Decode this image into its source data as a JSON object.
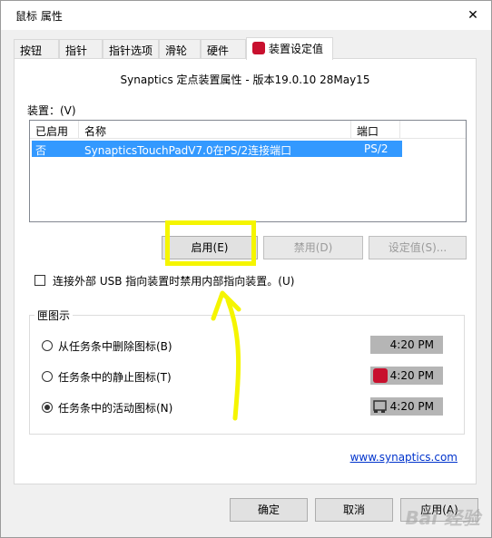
{
  "window": {
    "title": "鼠标 属性",
    "close_glyph": "✕"
  },
  "tabs": [
    "按钮",
    "指针",
    "指针选项",
    "滑轮",
    "硬件",
    "装置设定值"
  ],
  "header_text": "Synaptics 定点装置属性 - 版本19.0.10 28May15",
  "devices_label": "装置：(V)",
  "list": {
    "columns": [
      "已启用",
      "名称",
      "端口"
    ],
    "rows": [
      {
        "enabled": "否",
        "name": "SynapticsTouchPadV7.0在PS/2连接端口",
        "port": "PS/2"
      }
    ]
  },
  "buttons": {
    "enable": "启用(E)",
    "disable": "禁用(D)",
    "settings": "设定值(S)..."
  },
  "checkbox_label": "连接外部 USB 指向装置时禁用内部指向装置。(U)",
  "tray_group": {
    "title": "匣图示",
    "options": [
      {
        "label": "从任务条中删除图标(B)",
        "time": "4:20 PM",
        "checked": false,
        "icon": "none"
      },
      {
        "label": "任务条中的静止图标(T)",
        "time": "4:20 PM",
        "checked": false,
        "icon": "synaptics-static-icon"
      },
      {
        "label": "任务条中的活动图标(N)",
        "time": "4:20 PM",
        "checked": true,
        "icon": "synaptics-animated-icon"
      }
    ]
  },
  "link": "www.synaptics.com",
  "bottom_buttons": {
    "ok": "确定",
    "cancel": "取消",
    "apply": "应用(A)"
  },
  "watermark": "Bai 经验",
  "colors": {
    "selection": "#3399ff",
    "annotation": "#f5f500",
    "link": "#0033cc",
    "logo": "#c8102e"
  }
}
